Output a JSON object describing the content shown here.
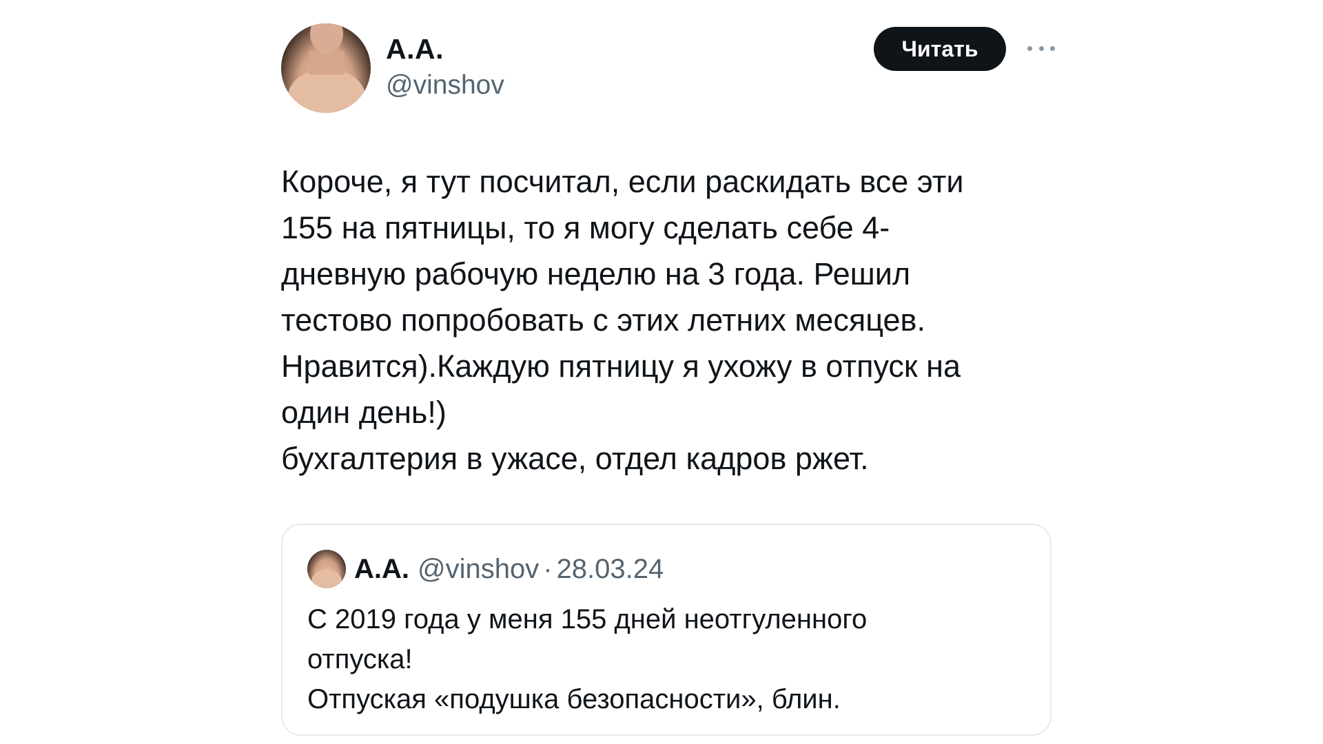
{
  "tweet": {
    "author": {
      "name": "A.A.",
      "handle": "@vinshov"
    },
    "follow_label": "Читать",
    "more_icon": "more-horizontal-icon",
    "text": "Короче, я тут посчитал, если раскидать все эти\n155 на пятницы, то я могу сделать себе 4-\nдневную рабочую неделю на 3 года. Решил\nтестово попробовать с этих летних месяцев.\nНравится).Каждую пятницу я ухожу в отпуск на\nодин день!)\nбухгалтерия в ужасе, отдел кадров ржет."
  },
  "quote": {
    "author": {
      "name": "A.A.",
      "handle": "@vinshov"
    },
    "separator": "·",
    "date": "28.03.24",
    "text": "С 2019 года у меня 155 дней неотгуленного\nотпуска!\nОтпуская «подушка безопасности», блин."
  },
  "colors": {
    "text": "#0f1419",
    "secondary": "#536471",
    "button_bg": "#0f1419",
    "button_text": "#ffffff",
    "border": "#e6e9ec"
  }
}
